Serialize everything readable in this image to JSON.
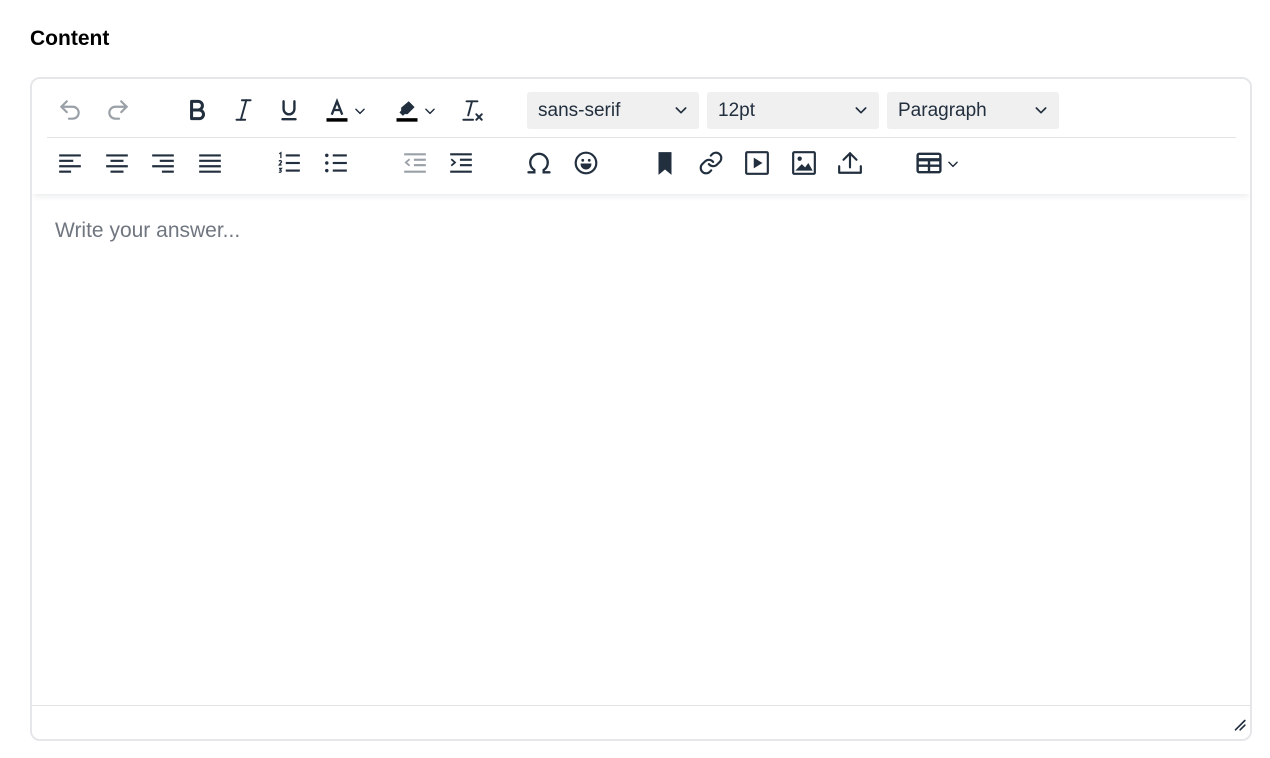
{
  "field": {
    "label": "Content"
  },
  "editor": {
    "placeholder": "Write your answer...",
    "toolbar": {
      "font_family": "sans-serif",
      "font_size": "12pt",
      "block_format": "Paragraph",
      "text_color": "#000000",
      "highlight_color": "#000000"
    },
    "icons": [
      "undo-icon",
      "redo-icon",
      "bold-icon",
      "italic-icon",
      "underline-icon",
      "text-color-icon",
      "highlight-color-icon",
      "remove-format-icon",
      "align-left-icon",
      "align-center-icon",
      "align-right-icon",
      "align-justify-icon",
      "numbered-list-icon",
      "bullet-list-icon",
      "outdent-icon",
      "indent-icon",
      "special-character-icon",
      "emoji-icon",
      "bookmark-icon",
      "link-icon",
      "media-icon",
      "image-icon",
      "upload-icon",
      "table-icon",
      "resize-handle-icon"
    ]
  },
  "colors": {
    "icon": "#222f3e",
    "border": "#e4e6e9",
    "select_bg": "#f0f0f0",
    "placeholder": "#707680"
  }
}
